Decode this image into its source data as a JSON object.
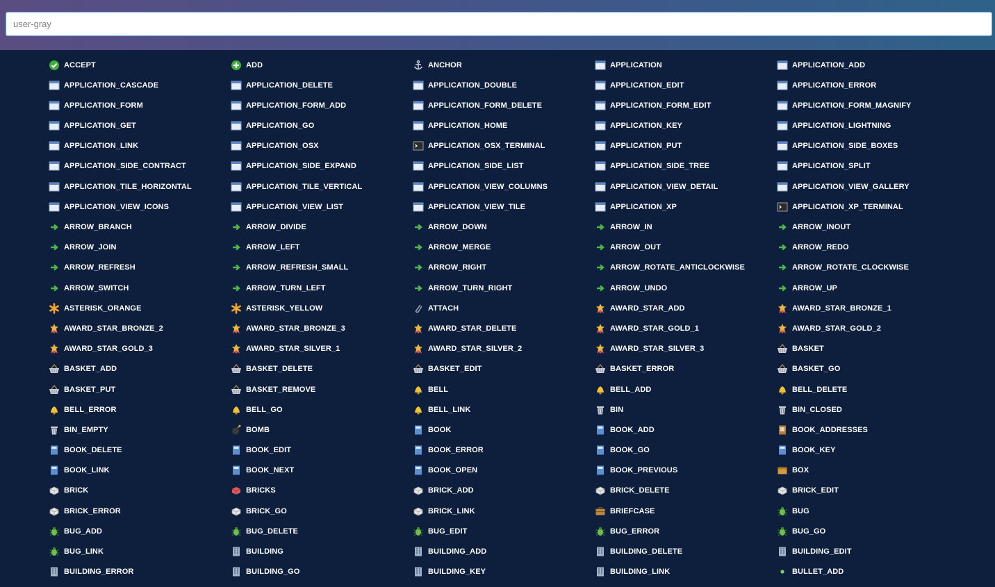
{
  "search": {
    "value": "user-gray"
  },
  "icons": [
    {
      "name": "ACCEPT",
      "type": "accept"
    },
    {
      "name": "ADD",
      "type": "add"
    },
    {
      "name": "ANCHOR",
      "type": "anchor"
    },
    {
      "name": "APPLICATION",
      "type": "app"
    },
    {
      "name": "APPLICATION_ADD",
      "type": "app"
    },
    {
      "name": "APPLICATION_CASCADE",
      "type": "app"
    },
    {
      "name": "APPLICATION_DELETE",
      "type": "app"
    },
    {
      "name": "APPLICATION_DOUBLE",
      "type": "app"
    },
    {
      "name": "APPLICATION_EDIT",
      "type": "app"
    },
    {
      "name": "APPLICATION_ERROR",
      "type": "app"
    },
    {
      "name": "APPLICATION_FORM",
      "type": "app"
    },
    {
      "name": "APPLICATION_FORM_ADD",
      "type": "app"
    },
    {
      "name": "APPLICATION_FORM_DELETE",
      "type": "app"
    },
    {
      "name": "APPLICATION_FORM_EDIT",
      "type": "app"
    },
    {
      "name": "APPLICATION_FORM_MAGNIFY",
      "type": "app"
    },
    {
      "name": "APPLICATION_GET",
      "type": "app"
    },
    {
      "name": "APPLICATION_GO",
      "type": "app"
    },
    {
      "name": "APPLICATION_HOME",
      "type": "app"
    },
    {
      "name": "APPLICATION_KEY",
      "type": "app"
    },
    {
      "name": "APPLICATION_LIGHTNING",
      "type": "app"
    },
    {
      "name": "APPLICATION_LINK",
      "type": "app"
    },
    {
      "name": "APPLICATION_OSX",
      "type": "app"
    },
    {
      "name": "APPLICATION_OSX_TERMINAL",
      "type": "terminal"
    },
    {
      "name": "APPLICATION_PUT",
      "type": "app"
    },
    {
      "name": "APPLICATION_SIDE_BOXES",
      "type": "app"
    },
    {
      "name": "APPLICATION_SIDE_CONTRACT",
      "type": "app"
    },
    {
      "name": "APPLICATION_SIDE_EXPAND",
      "type": "app"
    },
    {
      "name": "APPLICATION_SIDE_LIST",
      "type": "app"
    },
    {
      "name": "APPLICATION_SIDE_TREE",
      "type": "app"
    },
    {
      "name": "APPLICATION_SPLIT",
      "type": "app"
    },
    {
      "name": "APPLICATION_TILE_HORIZONTAL",
      "type": "app"
    },
    {
      "name": "APPLICATION_TILE_VERTICAL",
      "type": "app"
    },
    {
      "name": "APPLICATION_VIEW_COLUMNS",
      "type": "app"
    },
    {
      "name": "APPLICATION_VIEW_DETAIL",
      "type": "app"
    },
    {
      "name": "APPLICATION_VIEW_GALLERY",
      "type": "app"
    },
    {
      "name": "APPLICATION_VIEW_ICONS",
      "type": "app"
    },
    {
      "name": "APPLICATION_VIEW_LIST",
      "type": "app"
    },
    {
      "name": "APPLICATION_VIEW_TILE",
      "type": "app"
    },
    {
      "name": "APPLICATION_XP",
      "type": "app"
    },
    {
      "name": "APPLICATION_XP_TERMINAL",
      "type": "terminal"
    },
    {
      "name": "ARROW_BRANCH",
      "type": "arrow"
    },
    {
      "name": "ARROW_DIVIDE",
      "type": "arrow"
    },
    {
      "name": "ARROW_DOWN",
      "type": "arrow"
    },
    {
      "name": "ARROW_IN",
      "type": "arrow"
    },
    {
      "name": "ARROW_INOUT",
      "type": "arrow"
    },
    {
      "name": "ARROW_JOIN",
      "type": "arrow"
    },
    {
      "name": "ARROW_LEFT",
      "type": "arrow"
    },
    {
      "name": "ARROW_MERGE",
      "type": "arrow"
    },
    {
      "name": "ARROW_OUT",
      "type": "arrow"
    },
    {
      "name": "ARROW_REDO",
      "type": "arrow"
    },
    {
      "name": "ARROW_REFRESH",
      "type": "arrow"
    },
    {
      "name": "ARROW_REFRESH_SMALL",
      "type": "arrow"
    },
    {
      "name": "ARROW_RIGHT",
      "type": "arrow"
    },
    {
      "name": "ARROW_ROTATE_ANTICLOCKWISE",
      "type": "arrow"
    },
    {
      "name": "ARROW_ROTATE_CLOCKWISE",
      "type": "arrow"
    },
    {
      "name": "ARROW_SWITCH",
      "type": "arrow"
    },
    {
      "name": "ARROW_TURN_LEFT",
      "type": "arrow"
    },
    {
      "name": "ARROW_TURN_RIGHT",
      "type": "arrow"
    },
    {
      "name": "ARROW_UNDO",
      "type": "arrow"
    },
    {
      "name": "ARROW_UP",
      "type": "arrow"
    },
    {
      "name": "ASTERISK_ORANGE",
      "type": "asterisk"
    },
    {
      "name": "ASTERISK_YELLOW",
      "type": "asterisk"
    },
    {
      "name": "ATTACH",
      "type": "attach"
    },
    {
      "name": "AWARD_STAR_ADD",
      "type": "award"
    },
    {
      "name": "AWARD_STAR_BRONZE_1",
      "type": "award"
    },
    {
      "name": "AWARD_STAR_BRONZE_2",
      "type": "award"
    },
    {
      "name": "AWARD_STAR_BRONZE_3",
      "type": "award"
    },
    {
      "name": "AWARD_STAR_DELETE",
      "type": "award"
    },
    {
      "name": "AWARD_STAR_GOLD_1",
      "type": "award"
    },
    {
      "name": "AWARD_STAR_GOLD_2",
      "type": "award"
    },
    {
      "name": "AWARD_STAR_GOLD_3",
      "type": "award"
    },
    {
      "name": "AWARD_STAR_SILVER_1",
      "type": "award"
    },
    {
      "name": "AWARD_STAR_SILVER_2",
      "type": "award"
    },
    {
      "name": "AWARD_STAR_SILVER_3",
      "type": "award"
    },
    {
      "name": "BASKET",
      "type": "basket"
    },
    {
      "name": "BASKET_ADD",
      "type": "basket"
    },
    {
      "name": "BASKET_DELETE",
      "type": "basket"
    },
    {
      "name": "BASKET_EDIT",
      "type": "basket"
    },
    {
      "name": "BASKET_ERROR",
      "type": "basket"
    },
    {
      "name": "BASKET_GO",
      "type": "basket"
    },
    {
      "name": "BASKET_PUT",
      "type": "basket"
    },
    {
      "name": "BASKET_REMOVE",
      "type": "basket"
    },
    {
      "name": "BELL",
      "type": "bell"
    },
    {
      "name": "BELL_ADD",
      "type": "bell"
    },
    {
      "name": "BELL_DELETE",
      "type": "bell"
    },
    {
      "name": "BELL_ERROR",
      "type": "bell"
    },
    {
      "name": "BELL_GO",
      "type": "bell"
    },
    {
      "name": "BELL_LINK",
      "type": "bell"
    },
    {
      "name": "BIN",
      "type": "bin"
    },
    {
      "name": "BIN_CLOSED",
      "type": "bin"
    },
    {
      "name": "BIN_EMPTY",
      "type": "bin"
    },
    {
      "name": "BOMB",
      "type": "bomb"
    },
    {
      "name": "BOOK",
      "type": "book"
    },
    {
      "name": "BOOK_ADD",
      "type": "book"
    },
    {
      "name": "BOOK_ADDRESSES",
      "type": "bookbrown"
    },
    {
      "name": "BOOK_DELETE",
      "type": "book"
    },
    {
      "name": "BOOK_EDIT",
      "type": "book"
    },
    {
      "name": "BOOK_ERROR",
      "type": "book"
    },
    {
      "name": "BOOK_GO",
      "type": "book"
    },
    {
      "name": "BOOK_KEY",
      "type": "book"
    },
    {
      "name": "BOOK_LINK",
      "type": "book"
    },
    {
      "name": "BOOK_NEXT",
      "type": "book"
    },
    {
      "name": "BOOK_OPEN",
      "type": "book"
    },
    {
      "name": "BOOK_PREVIOUS",
      "type": "book"
    },
    {
      "name": "BOX",
      "type": "box"
    },
    {
      "name": "BRICK",
      "type": "brick"
    },
    {
      "name": "BRICKS",
      "type": "bricks"
    },
    {
      "name": "BRICK_ADD",
      "type": "brick"
    },
    {
      "name": "BRICK_DELETE",
      "type": "brick"
    },
    {
      "name": "BRICK_EDIT",
      "type": "brick"
    },
    {
      "name": "BRICK_ERROR",
      "type": "brick"
    },
    {
      "name": "BRICK_GO",
      "type": "brick"
    },
    {
      "name": "BRICK_LINK",
      "type": "brick"
    },
    {
      "name": "BRIEFCASE",
      "type": "briefcase"
    },
    {
      "name": "BUG",
      "type": "bug"
    },
    {
      "name": "BUG_ADD",
      "type": "bug"
    },
    {
      "name": "BUG_DELETE",
      "type": "bug"
    },
    {
      "name": "BUG_EDIT",
      "type": "bug"
    },
    {
      "name": "BUG_ERROR",
      "type": "bug"
    },
    {
      "name": "BUG_GO",
      "type": "bug"
    },
    {
      "name": "BUG_LINK",
      "type": "bug"
    },
    {
      "name": "BUILDING",
      "type": "building"
    },
    {
      "name": "BUILDING_ADD",
      "type": "building"
    },
    {
      "name": "BUILDING_DELETE",
      "type": "building"
    },
    {
      "name": "BUILDING_EDIT",
      "type": "building"
    },
    {
      "name": "BUILDING_ERROR",
      "type": "building"
    },
    {
      "name": "BUILDING_GO",
      "type": "building"
    },
    {
      "name": "BUILDING_KEY",
      "type": "building"
    },
    {
      "name": "BUILDING_LINK",
      "type": "building"
    },
    {
      "name": "BULLET_ADD",
      "type": "bullet"
    }
  ],
  "icon_colors": {
    "accept": "#3fae3a",
    "add": "#3fae3a",
    "anchor": "#c8d0dc",
    "app": "#e8eef6",
    "terminal": "#e8eef6",
    "arrow": "#4cb84a",
    "asterisk": "#f4a62a",
    "attach": "#9aa3ad",
    "award": "#e8b93a",
    "basket": "#c9ced6",
    "bell": "#f1c232",
    "bin": "#c9ced6",
    "bomb": "#7a7a7a",
    "book": "#5b8fd0",
    "bookbrown": "#b07a3b",
    "box": "#d49a3e",
    "brick": "#e6e6e6",
    "bricks": "#e35a5a",
    "briefcase": "#c08a3e",
    "bug": "#6fbf4a",
    "building": "#9fb2c8",
    "bullet": "#7fd05c"
  }
}
